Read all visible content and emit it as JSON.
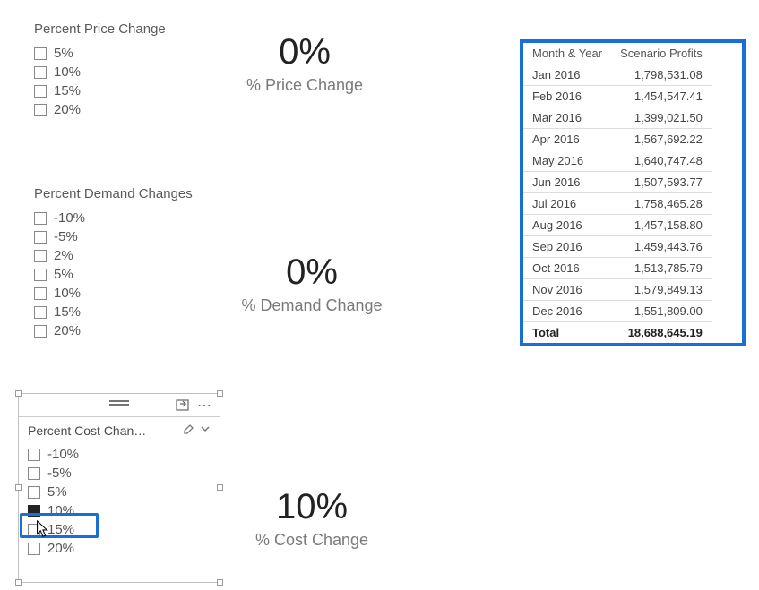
{
  "slicers": {
    "price": {
      "title": "Percent Price Change",
      "items": [
        "5%",
        "10%",
        "15%",
        "20%"
      ]
    },
    "demand": {
      "title": "Percent Demand Changes",
      "items": [
        "-10%",
        "-5%",
        "2%",
        "5%",
        "10%",
        "15%",
        "20%"
      ]
    },
    "cost": {
      "title": "Percent Cost Chan…",
      "items": [
        "-10%",
        "-5%",
        "5%",
        "10%",
        "15%",
        "20%"
      ],
      "selected_index": 3
    }
  },
  "kpis": {
    "price": {
      "value": "0%",
      "label": "% Price Change"
    },
    "demand": {
      "value": "0%",
      "label": "% Demand Change"
    },
    "cost": {
      "value": "10%",
      "label": "% Cost Change"
    }
  },
  "table": {
    "headers": {
      "month": "Month & Year",
      "profit": "Scenario Profits"
    },
    "rows": [
      {
        "month": "Jan 2016",
        "profit": "1,798,531.08"
      },
      {
        "month": "Feb 2016",
        "profit": "1,454,547.41"
      },
      {
        "month": "Mar 2016",
        "profit": "1,399,021.50"
      },
      {
        "month": "Apr 2016",
        "profit": "1,567,692.22"
      },
      {
        "month": "May 2016",
        "profit": "1,640,747.48"
      },
      {
        "month": "Jun 2016",
        "profit": "1,507,593.77"
      },
      {
        "month": "Jul 2016",
        "profit": "1,758,465.28"
      },
      {
        "month": "Aug 2016",
        "profit": "1,457,158.80"
      },
      {
        "month": "Sep 2016",
        "profit": "1,459,443.76"
      },
      {
        "month": "Oct 2016",
        "profit": "1,513,785.79"
      },
      {
        "month": "Nov 2016",
        "profit": "1,579,849.13"
      },
      {
        "month": "Dec 2016",
        "profit": "1,551,809.00"
      }
    ],
    "total": {
      "label": "Total",
      "profit": "18,688,645.19"
    }
  }
}
